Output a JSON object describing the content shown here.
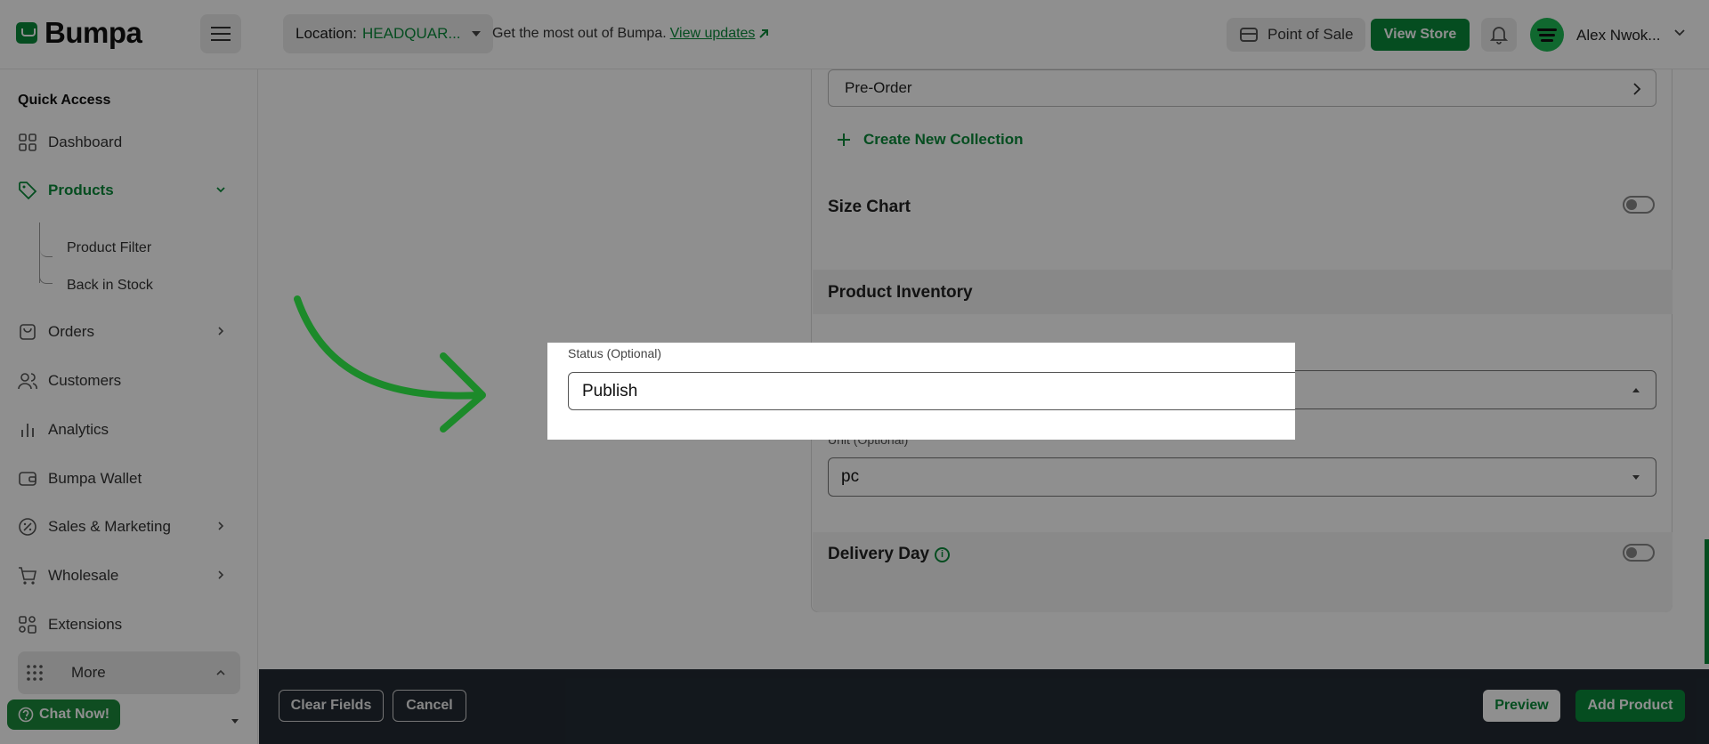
{
  "brand": {
    "name": "Bumpa",
    "accent": "#0a8a3a"
  },
  "header": {
    "location_label": "Location:",
    "location_value": "HEADQUAR...",
    "promo_text": "Get the most out of Bumpa.",
    "promo_link": "View updates",
    "pos_label": "Point of Sale",
    "view_store_label": "View Store",
    "user_name": "Alex Nwok..."
  },
  "sidebar": {
    "heading": "Quick Access",
    "items": [
      {
        "label": "Dashboard",
        "icon": "grid-icon"
      },
      {
        "label": "Products",
        "icon": "tag-icon"
      },
      {
        "label": "Orders",
        "icon": "bag-icon"
      },
      {
        "label": "Customers",
        "icon": "people-icon"
      },
      {
        "label": "Analytics",
        "icon": "bar-chart-icon"
      },
      {
        "label": "Bumpa Wallet",
        "icon": "wallet-icon"
      },
      {
        "label": "Sales & Marketing",
        "icon": "percent-icon"
      },
      {
        "label": "Wholesale",
        "icon": "cart-icon"
      },
      {
        "label": "Extensions",
        "icon": "extensions-icon"
      }
    ],
    "sub_items": [
      "Product Filter",
      "Back in Stock"
    ],
    "more_label": "More",
    "chat_label": "Chat Now!"
  },
  "form": {
    "collection_value": "Pre-Order",
    "create_collection": "Create New Collection",
    "size_chart_label": "Size Chart",
    "inventory_title": "Product Inventory",
    "status_label": "Status (Optional)",
    "status_value": "Publish",
    "unit_label": "Unit (Optional)",
    "unit_value": "pc",
    "delivery_label": "Delivery Day"
  },
  "footer": {
    "clear_label": "Clear Fields",
    "cancel_label": "Cancel",
    "preview_label": "Preview",
    "add_label": "Add Product"
  }
}
